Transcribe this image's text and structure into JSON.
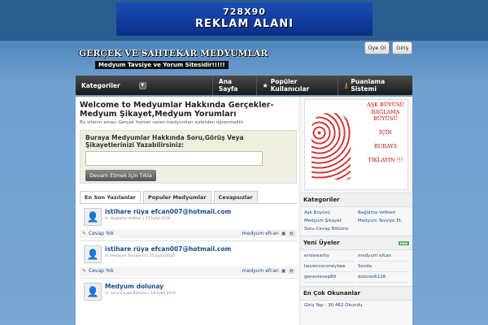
{
  "banner": {
    "line1": "728X90",
    "line2": "REKLAM ALANI"
  },
  "logo": {
    "title": "GERÇEK VE SAHTEKAR MEDYUMLAR",
    "subtitle": "Medyum Tavsiye ve Yorum Sitesidir!!!!!"
  },
  "user_links": {
    "register": "Üye Ol",
    "login": "Giriş"
  },
  "nav": {
    "categories": "Kategoriler",
    "home": "Ana Sayfa",
    "popular_users": "Popüler Kullanıcılar",
    "scoring": "Puanlama Sistemi"
  },
  "welcome": {
    "title": "Welcome to Medyumlar Hakkında Gerçekler-Medyum Şikayet,Medyum Yorumları",
    "desc": "Bu sitenin amacı Gerçek hizmet veren medyumları sizlerden öğrenmektir"
  },
  "ask": {
    "question": "Buraya Medyumlar Hakkında Soru,Görüş Veya Şikayetlerinizi Yazabilirsiniz:",
    "button": "Devam Etmek İçin Tıkla"
  },
  "tabs": [
    "En Son Yazılanlar",
    "Populer Medyumlar",
    "Cevapsızlar"
  ],
  "posts": [
    {
      "title": "istihare rüya efcan007@hotmail.com",
      "meta": "In: Bağlama Vefkleri | 25 Eylül 2016",
      "answer": "Cevap Yok",
      "author": "medyum efcan",
      "count": "0"
    },
    {
      "title": "istihare rüya efcan007@hotmail.com",
      "meta": "In: Medyum Tavsiye Et | 25 Eylül 2016",
      "answer": "Cevap Yok",
      "author": "medyum efcan",
      "count": "0"
    },
    {
      "title": "Medyum dolunay",
      "meta": "In: Soru-Cevap Bölümü | 18 Eylül 2016"
    }
  ],
  "side_ad": {
    "l1": "AŞK BÜYÜSÜ",
    "l2": "BAĞLAMA",
    "l3": "BÜYÜSÜ",
    "l4": "İÇİN",
    "l5": "BURAYA",
    "l6": "TIKLAYIN !!!"
  },
  "sidebar": {
    "categories_title": "Kategoriler",
    "categories": [
      "Aşk Büyüsü",
      "Bağlama Vefkleri",
      "Medyum Şikayet",
      "Medyum Tavsiye Et.",
      "Soru-Cevap Bölümü",
      ""
    ],
    "new_users_title": "Yeni Üyeler",
    "new_badge": "new",
    "users": [
      "erniewarby",
      "medyum efcan",
      "laurenceconeybee",
      "Sevda",
      "genevievep89",
      "dolores6128"
    ],
    "most_read_title": "En Çok Okunanlar",
    "most_read": [
      "Giriş Yap - 30.462 Okundu"
    ]
  }
}
